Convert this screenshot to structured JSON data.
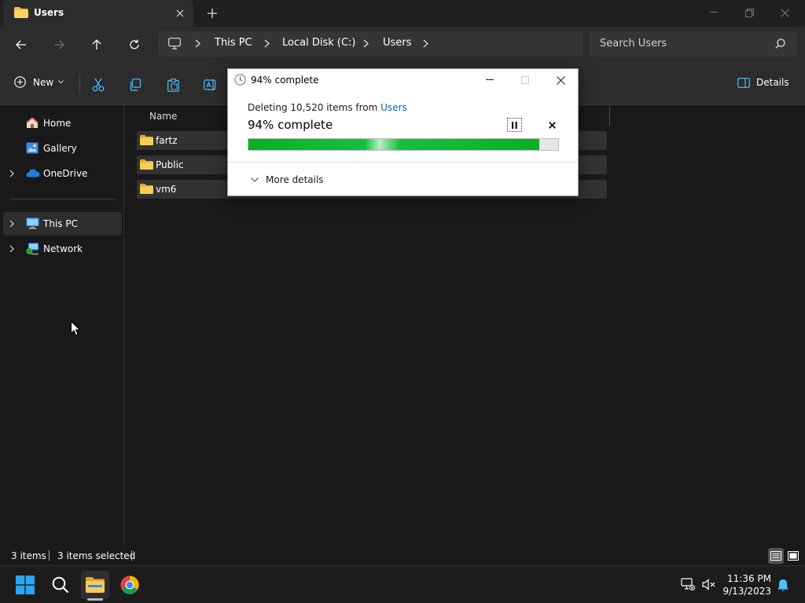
{
  "window": {
    "tab_title": "Users",
    "new_tab_symbol": "+"
  },
  "address_bar": {
    "crumbs": [
      "This PC",
      "Local Disk (C:)",
      "Users"
    ],
    "search_placeholder": "Search Users"
  },
  "command_bar": {
    "new_label": "New",
    "details_label": "Details"
  },
  "sidebar": {
    "items": [
      {
        "label": "Home",
        "icon": "home-icon"
      },
      {
        "label": "Gallery",
        "icon": "gallery-icon"
      },
      {
        "label": "OneDrive",
        "icon": "onedrive-icon"
      },
      {
        "label": "This PC",
        "icon": "this-pc-icon"
      },
      {
        "label": "Network",
        "icon": "network-icon"
      }
    ]
  },
  "file_list": {
    "column_name": "Name",
    "files": [
      {
        "name": "fartz"
      },
      {
        "name": "Public"
      },
      {
        "name": "vm6"
      }
    ]
  },
  "status_bar": {
    "item_count": "3 items",
    "selected_count": "3 items selected"
  },
  "dialog": {
    "title": "94% complete",
    "message_prefix": "Deleting 10,520 items from ",
    "message_link": "Users",
    "big_status": "94% complete",
    "progress_percent": 94,
    "more_details_label": "More details"
  },
  "taskbar": {
    "time": "11:36 PM",
    "date": "9/13/2023"
  },
  "colors": {
    "folder_yellow": "#f3c042",
    "progress_green": "#06b025",
    "link_blue": "#0063b1",
    "accent_blue": "#4cc2ff"
  }
}
